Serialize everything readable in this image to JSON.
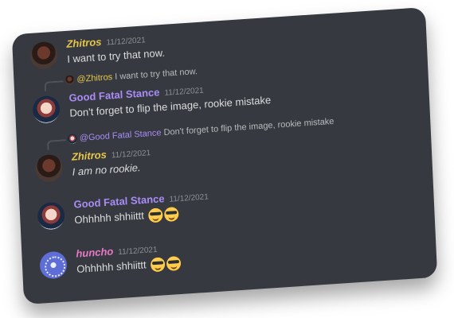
{
  "messages": [
    {
      "author": "Zhitros",
      "timestamp": "11/12/2021",
      "text": "I want to try that now.",
      "avatar": "zhitros-avatar"
    },
    {
      "reply": {
        "author": "@Zhitros",
        "text": "I want to try that now."
      },
      "author": "Good Fatal Stance",
      "timestamp": "11/12/2021",
      "text": "Don't forget to flip the image, rookie mistake",
      "avatar": "good-fatal-stance-avatar"
    },
    {
      "reply": {
        "author": "@Good Fatal Stance",
        "text": "Don't forget to flip the image, rookie mistake"
      },
      "author": "Zhitros",
      "timestamp": "11/12/2021",
      "text": "I am no rookie.",
      "avatar": "zhitros-avatar"
    },
    {
      "author": "Good Fatal Stance",
      "timestamp": "11/12/2021",
      "text": "Ohhhhh shhiittt",
      "emojis": [
        "sunglasses-emoji",
        "sunglasses-emoji"
      ],
      "avatar": "good-fatal-stance-avatar"
    },
    {
      "author": "huncho",
      "timestamp": "11/12/2021",
      "text": "Ohhhhh shhiittt",
      "emojis": [
        "sunglasses-emoji",
        "sunglasses-emoji"
      ],
      "avatar": "huncho-avatar"
    }
  ],
  "colors": {
    "background": "#36393f",
    "zhitros_name": "#e6c74b",
    "good_fatal_stance_name": "#a98cf6",
    "huncho_name": "#e878c8",
    "timestamp": "#8e9297",
    "message_text": "#dcddde"
  }
}
